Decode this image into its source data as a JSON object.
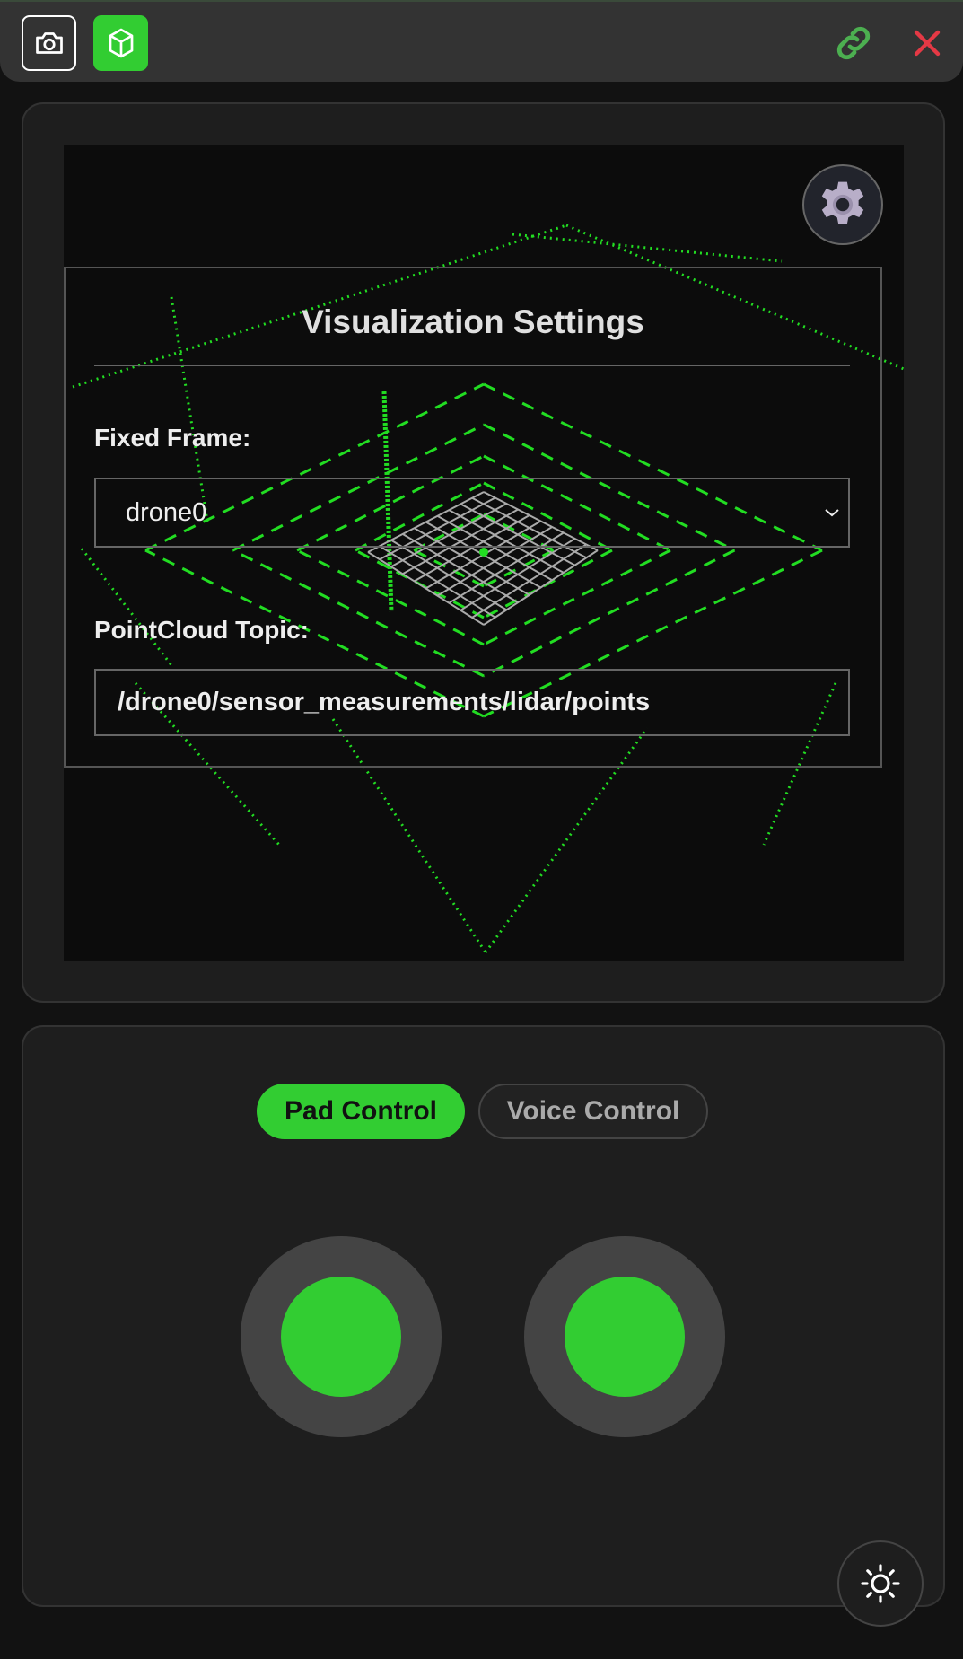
{
  "header": {
    "camera_icon": "camera-icon",
    "cube_icon": "cube-icon",
    "link_icon": "link-icon",
    "close_icon": "close-icon",
    "accent": "#32cd32",
    "link_color": "#4caf50",
    "close_color": "#e53945"
  },
  "viewer": {
    "point_color": "#22dd22",
    "settings": {
      "title": "Visualization Settings",
      "fixed_frame_label": "Fixed Frame:",
      "fixed_frame_value": "drone0",
      "pointcloud_label": "PointCloud Topic:",
      "pointcloud_value": "/drone0/sensor_measurements/lidar/points"
    }
  },
  "control": {
    "tabs": [
      {
        "label": "Pad Control",
        "active": true
      },
      {
        "label": "Voice Control",
        "active": false
      }
    ]
  }
}
